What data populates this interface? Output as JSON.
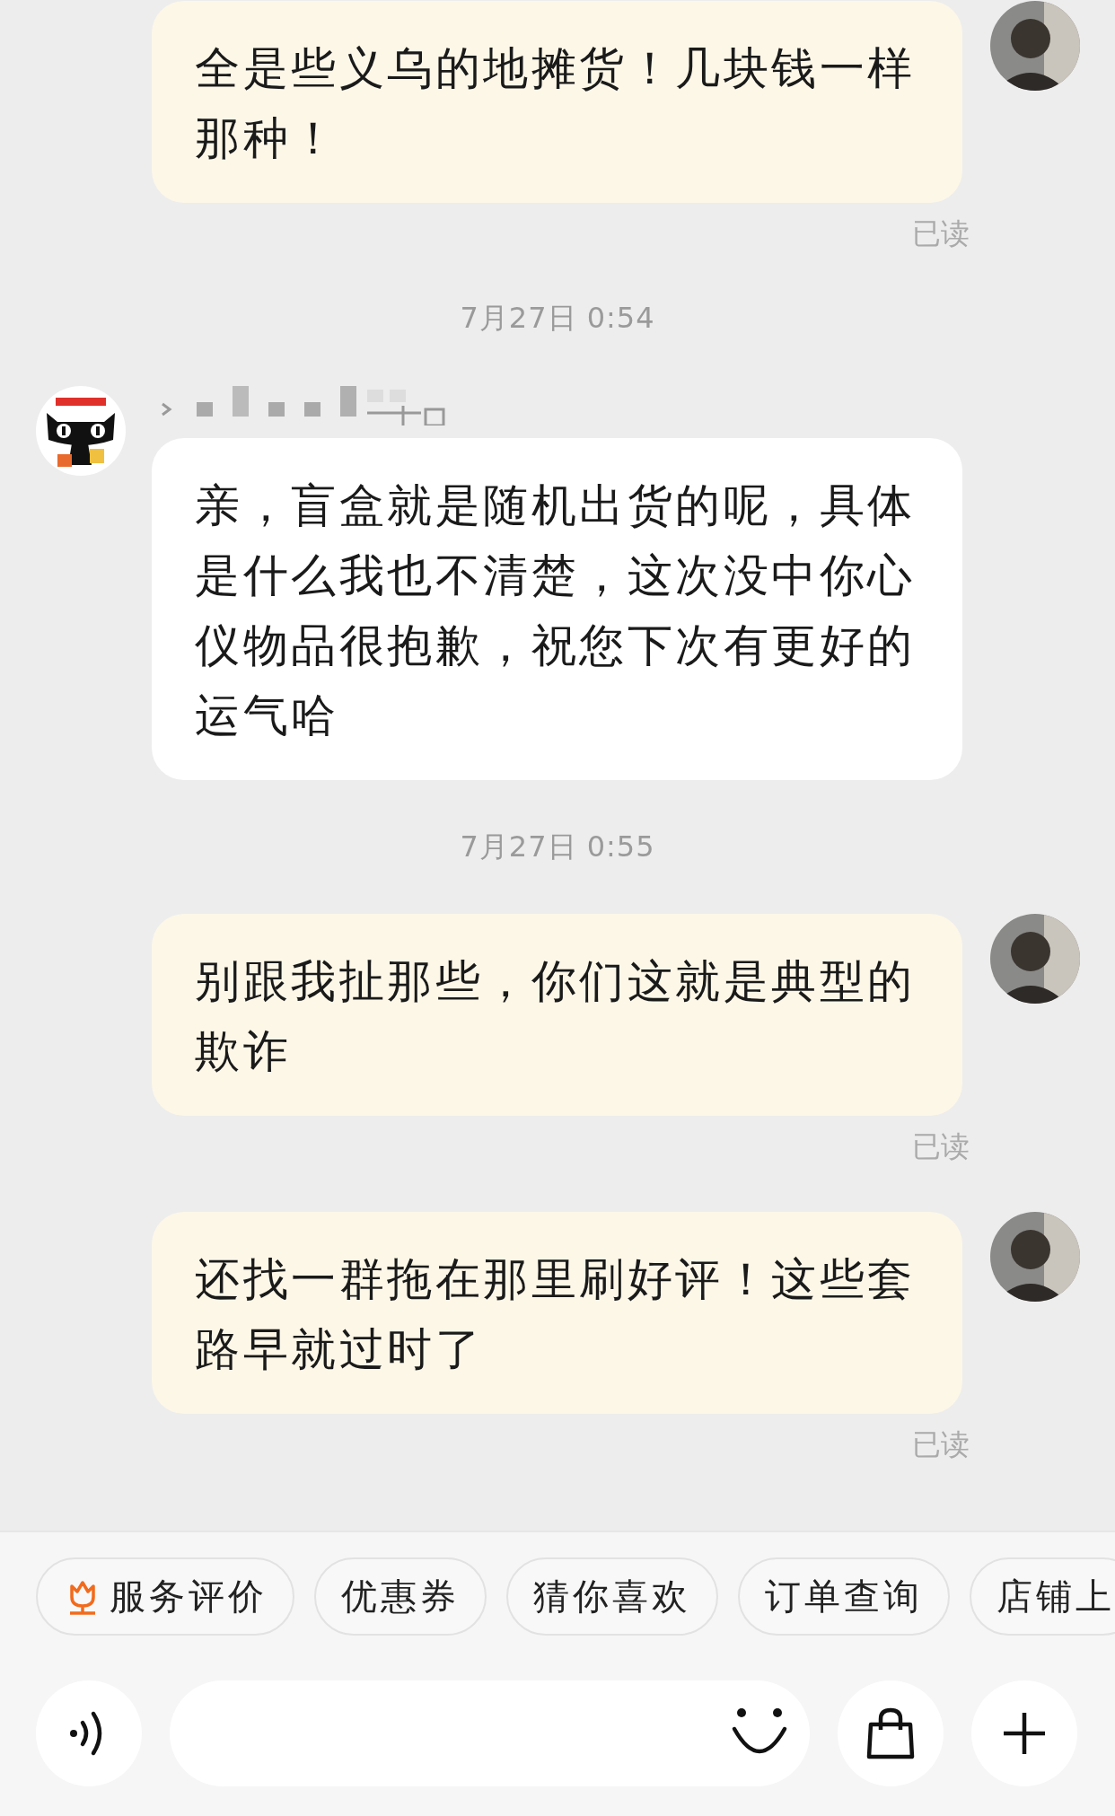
{
  "messages": [
    {
      "kind": "outgoing",
      "text": "全是些义乌的地摊货！几块钱一样那种！",
      "status": "已读"
    },
    {
      "kind": "time",
      "text": "7月27日 0:54"
    },
    {
      "kind": "incoming",
      "text": "亲，盲盒就是随机出货的呢，具体是什么我也不清楚，这次没中你心仪物品很抱歉，祝您下次有更好的运气哈"
    },
    {
      "kind": "time",
      "text": "7月27日 0:55"
    },
    {
      "kind": "outgoing",
      "text": "别跟我扯那些，你们这就是典型的欺诈",
      "status": "已读"
    },
    {
      "kind": "outgoing",
      "text": "还找一群拖在那里刷好评！这些套路早就过时了",
      "status": "已读"
    }
  ],
  "quick_replies": [
    {
      "label": "服务评价",
      "has_icon": true
    },
    {
      "label": "优惠券",
      "has_icon": false
    },
    {
      "label": "猜你喜欢",
      "has_icon": false
    },
    {
      "label": "订单查询",
      "has_icon": false
    },
    {
      "label": "店铺上",
      "has_icon": false
    }
  ]
}
